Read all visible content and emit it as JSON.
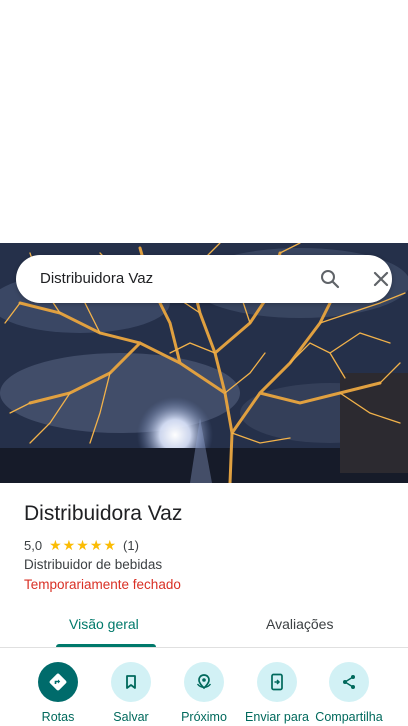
{
  "search": {
    "query": "Distribuidora Vaz"
  },
  "place": {
    "title": "Distribuidora Vaz",
    "rating": "5,0",
    "stars": 5,
    "review_count": "(1)",
    "category": "Distribuidor de bebidas",
    "status": "Temporariamente fechado"
  },
  "tabs": [
    {
      "label": "Visão geral",
      "active": true
    },
    {
      "label": "Avaliações",
      "active": false
    }
  ],
  "actions": [
    {
      "label": "Rotas",
      "icon": "directions-icon"
    },
    {
      "label": "Salvar",
      "icon": "bookmark-icon"
    },
    {
      "label": "Próximo",
      "icon": "nearby-icon"
    },
    {
      "label": "Enviar para",
      "icon": "send-to-phone-icon"
    },
    {
      "label": "Compartilha",
      "icon": "share-icon"
    }
  ],
  "colors": {
    "accent": "#00796b",
    "closed": "#d93025",
    "star": "#fbbc04",
    "chip": "#d2f1f5"
  }
}
